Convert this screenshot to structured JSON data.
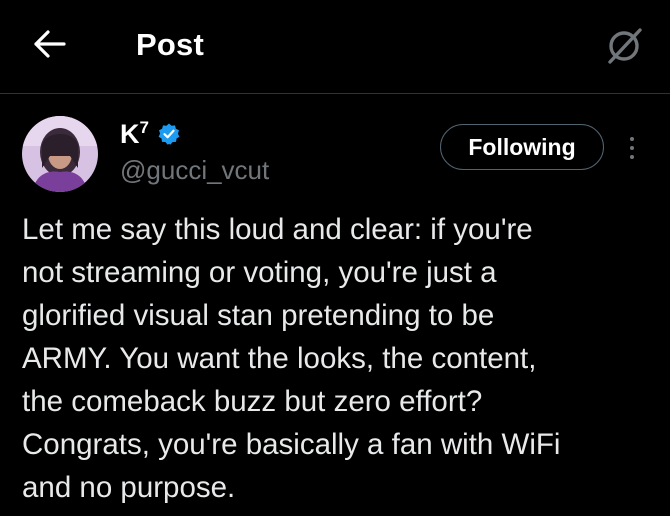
{
  "header": {
    "title": "Post",
    "back_icon": "arrow-left-icon",
    "grok_icon": "grok-icon"
  },
  "post": {
    "author": {
      "display_name": "K",
      "display_name_superscript": "7",
      "verified_icon": "verified-badge-icon",
      "verified_color": "#1d9bf0",
      "handle": "@gucci_vcut"
    },
    "follow_label": "Following",
    "more_icon": "more-vertical-icon",
    "text": "Let me say this loud and clear: if you're\nnot streaming or voting, you're just a\nglorified visual stan pretending to be\nARMY. You want the looks, the content,\nthe comeback buzz but zero effort?\nCongrats, you're basically a fan with WiFi\nand no purpose."
  },
  "colors": {
    "background": "#000000",
    "primary_text": "#e7e9ea",
    "secondary_text": "#71767b",
    "divider": "#2f3336"
  }
}
